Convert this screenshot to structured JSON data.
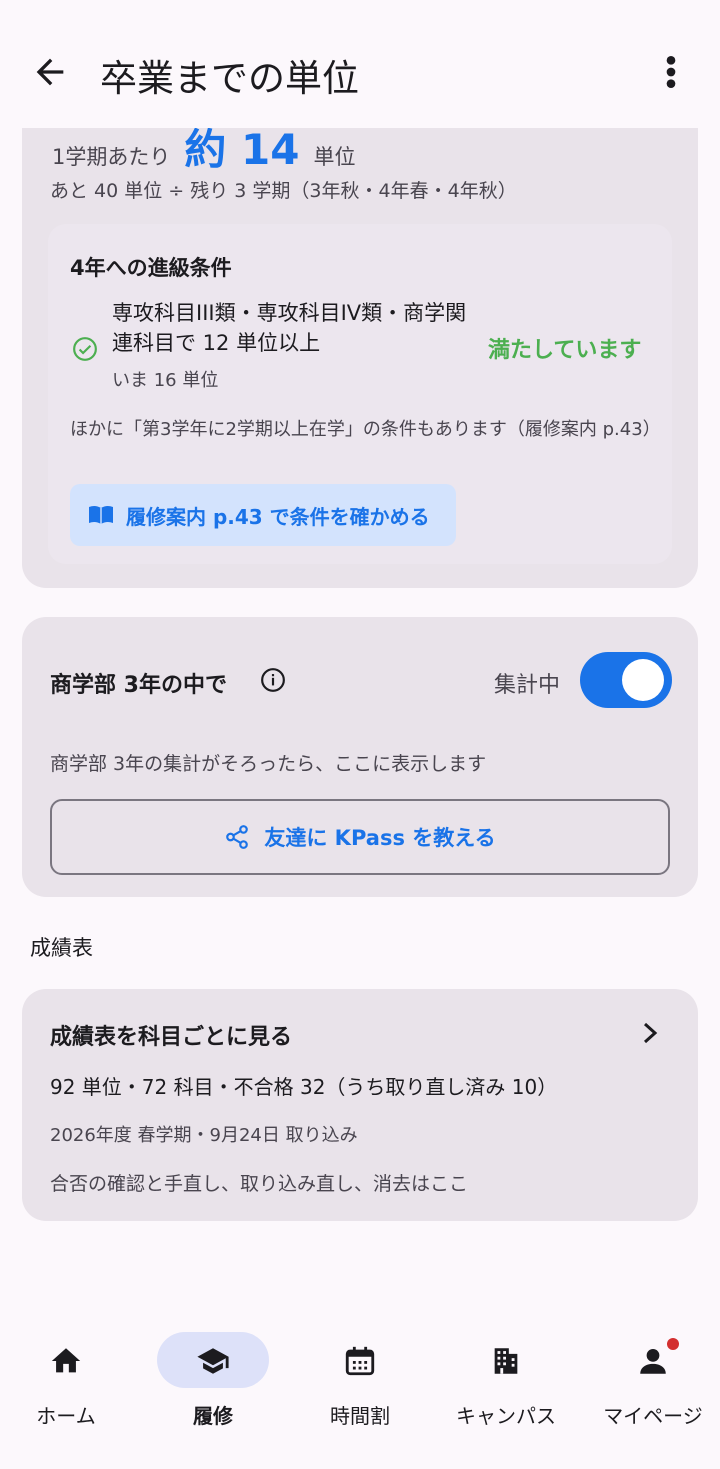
{
  "appbar": {
    "title": "卒業までの単位"
  },
  "plan": {
    "per_term_prefix": "1学期あたり",
    "per_term_value": "約 14",
    "per_term_unit": "単位",
    "formula": "あと 40 単位 ÷ 残り 3 学期（3年秋・4年春・4年秋）"
  },
  "promotion": {
    "heading": "4年への進級条件",
    "condition": "専攻科目III類・専攻科目IV類・商学関連科目で 12 単位以上",
    "current": "いま 16 単位",
    "status": "満たしています",
    "note": "ほかに「第3学年に2学期以上在学」の条件もあります（履修案内 p.43）",
    "guide_button": "履修案内 p.43 で条件を確かめる"
  },
  "peer": {
    "heading": "商学部 3年の中で",
    "aggregate_label": "集計中",
    "toggle_on": true,
    "description": "商学部 3年の集計がそろったら、ここに表示します",
    "share_button": "友達に KPass を教える"
  },
  "grades_section": {
    "title": "成績表"
  },
  "grades_card": {
    "heading": "成績表を科目ごとに見る",
    "summary": "92 単位・72 科目・不合格 32（うち取り直し済み 10）",
    "imported": "2026年度 春学期・9月24日 取り込み",
    "hint": "合否の確認と手直し、取り込み直し、消去はここ"
  },
  "nav": {
    "items": [
      {
        "label": "ホーム",
        "icon": "home-icon"
      },
      {
        "label": "履修",
        "icon": "graduation-cap-icon",
        "active": true
      },
      {
        "label": "時間割",
        "icon": "calendar-icon"
      },
      {
        "label": "キャンパス",
        "icon": "building-icon"
      },
      {
        "label": "マイページ",
        "icon": "person-icon",
        "badge": true
      }
    ]
  },
  "colors": {
    "accent": "#1a73e8",
    "success": "#4caf50",
    "card": "#e9e3ea",
    "badge": "#d32f2f"
  }
}
